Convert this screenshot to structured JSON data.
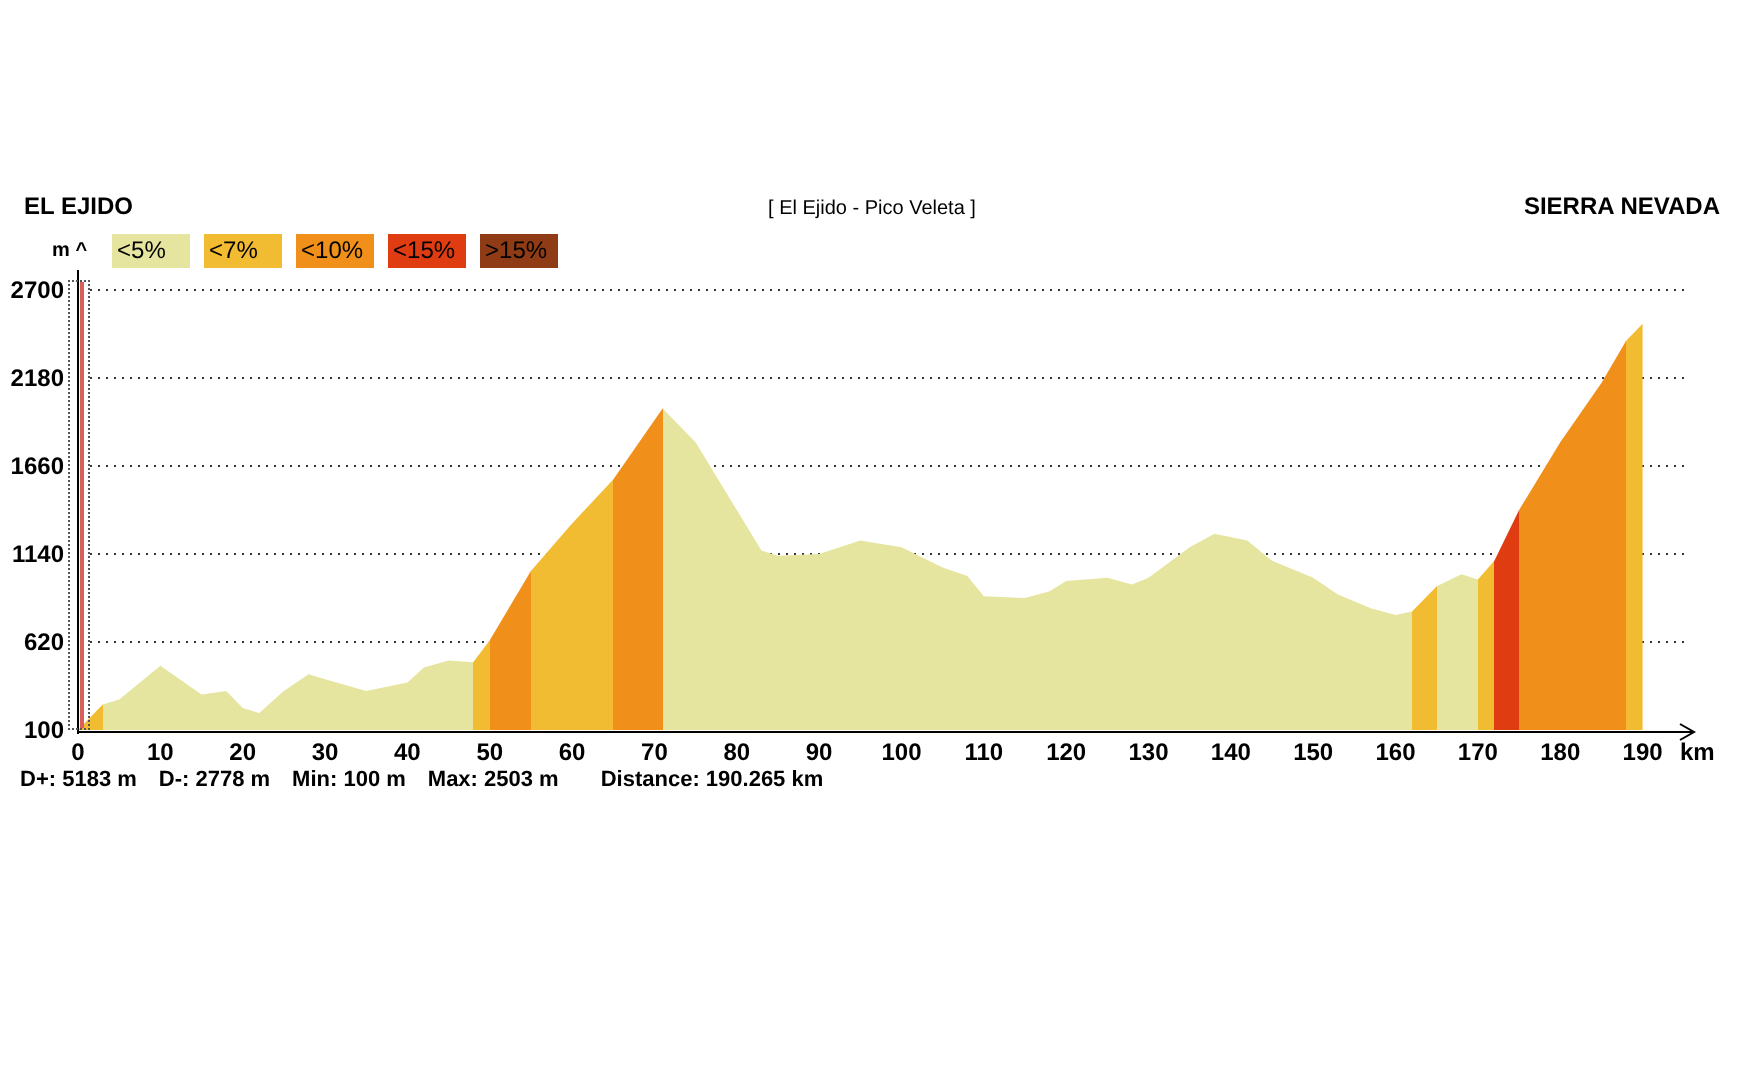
{
  "header": {
    "start": "EL EJIDO",
    "route": "[ El Ejido - Pico Veleta ]",
    "end": "SIERRA NEVADA"
  },
  "y_axis_arrow": "^",
  "legend": [
    {
      "label": "<5%",
      "color": "#e5e59f"
    },
    {
      "label": "<7%",
      "color": "#f2bc32"
    },
    {
      "label": "<10%",
      "color": "#f0901b"
    },
    {
      "label": "<15%",
      "color": "#e03c12"
    },
    {
      "label": ">15%",
      "color": "#8f3c16"
    }
  ],
  "chart_data": {
    "type": "area",
    "xlabel": "km",
    "ylabel": "m",
    "x": [
      0,
      3,
      5,
      10,
      15,
      18,
      20,
      22,
      25,
      28,
      30,
      35,
      40,
      42,
      45,
      48,
      50,
      55,
      60,
      65,
      70,
      71,
      75,
      80,
      83,
      85,
      90,
      95,
      100,
      105,
      108,
      110,
      115,
      118,
      120,
      125,
      128,
      130,
      135,
      138,
      142,
      145,
      150,
      153,
      157,
      160,
      162,
      165,
      168,
      170,
      172,
      175,
      180,
      185,
      188,
      190
    ],
    "series": [
      {
        "color": "#e5e59f",
        "values": [
          100,
          250,
          280,
          480,
          310,
          330,
          230,
          200,
          330,
          430,
          400,
          330,
          380,
          470,
          510,
          500,
          630,
          1040,
          1320,
          1580,
          1930,
          2000,
          1800,
          1400,
          1160,
          1130,
          1140,
          1220,
          1180,
          1060,
          1010,
          890,
          880,
          920,
          980,
          1000,
          960,
          1000,
          1180,
          1260,
          1220,
          1100,
          1000,
          900,
          820,
          780,
          800,
          950,
          1020,
          990,
          1100,
          1400,
          1800,
          2150,
          2400,
          2500
        ]
      }
    ],
    "xlim": [
      0,
      196
    ],
    "ylim": [
      100,
      2700
    ],
    "grid": true,
    "xticks": [
      0,
      10,
      20,
      30,
      40,
      50,
      60,
      70,
      80,
      90,
      100,
      110,
      120,
      130,
      140,
      150,
      160,
      170,
      180,
      190
    ],
    "yticks": [
      100,
      620,
      1140,
      1660,
      2180,
      2700
    ]
  },
  "stats": [
    "D+: 5183 m",
    "D-: 2778 m",
    "Min: 100 m",
    "Max: 2503 m",
    "Distance: 190.265 km"
  ]
}
